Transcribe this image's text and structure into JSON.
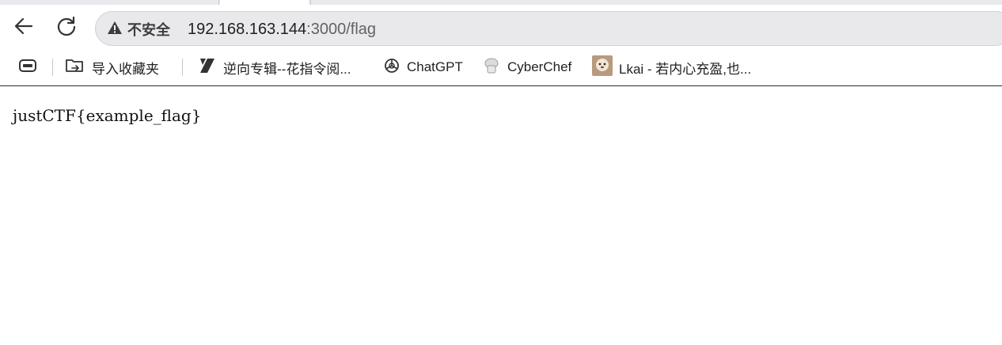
{
  "browser": {
    "back_icon": "arrow-left-icon",
    "reload_icon": "reload-icon",
    "security_label": "不安全",
    "url": {
      "host": "192.168.163.144",
      "rest": ":3000/flag"
    }
  },
  "bookmarks": {
    "items": [
      {
        "icon": "apps-icon",
        "label": ""
      },
      {
        "icon": "import-folder-icon",
        "label": "导入收藏夹"
      },
      {
        "icon": "bookmark-site-icon",
        "label": "逆向专辑--花指令阅..."
      },
      {
        "icon": "openai-icon",
        "label": "ChatGPT"
      },
      {
        "icon": "chef-hat-icon",
        "label": "CyberChef"
      },
      {
        "icon": "avatar-icon",
        "label": "Lkai - 若内心充盈,也..."
      }
    ]
  },
  "page": {
    "text": "justCTF{example_flag}"
  },
  "colors": {
    "omnibox_bg": "#e9e9ec",
    "tabstrip_bg": "#e9eaed",
    "text": "#202124"
  }
}
